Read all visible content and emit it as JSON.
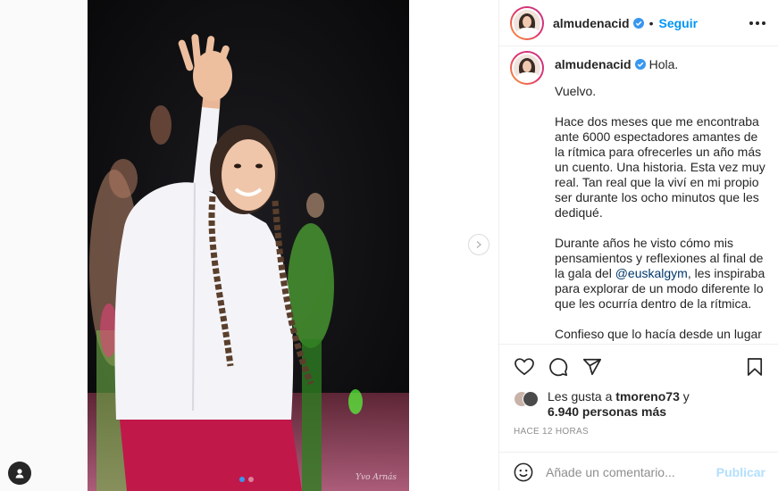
{
  "post": {
    "username": "almudenacid",
    "follow_label": "Seguir",
    "separator": "•",
    "caption": {
      "first_line": "Hola.",
      "paragraphs": [
        "Vuelvo.",
        "Hace dos meses que me encontraba ante 6000 espectadores amantes de la rítmica para ofrecerles un año más un cuento. Una historia. Esta vez muy real. Tan real que la viví en mi propio ser durante los ocho minutos que les dediqué.",
        "Durante años he visto cómo mis pensamientos y reflexiones al final de la gala del ",
        "Confieso que lo hacía desde un lugar"
      ],
      "mention": "@euskalgym",
      "after_mention": ", les inspiraba para explorar de un modo diferente lo que les ocurría dentro de la rítmica."
    },
    "likes": {
      "prefix": "Les gusta a",
      "user": "tmoreno73",
      "conjunction": "y",
      "count": "6.940 personas más"
    },
    "timestamp": "HACE 12 HORAS",
    "comment": {
      "placeholder": "Añade un comentario...",
      "publish_label": "Publicar"
    },
    "carousel": {
      "count": 2,
      "active_index": 0
    }
  },
  "watermark": "Yvo Arnás",
  "colors": {
    "follow": "#0095f6",
    "verified": "#3897f0",
    "publish_disabled": "#b2dffc"
  },
  "icons": [
    "heart-icon",
    "comment-icon",
    "share-icon",
    "bookmark-icon",
    "emoji-icon",
    "more-icon",
    "chevron-right-icon",
    "profile-icon"
  ]
}
